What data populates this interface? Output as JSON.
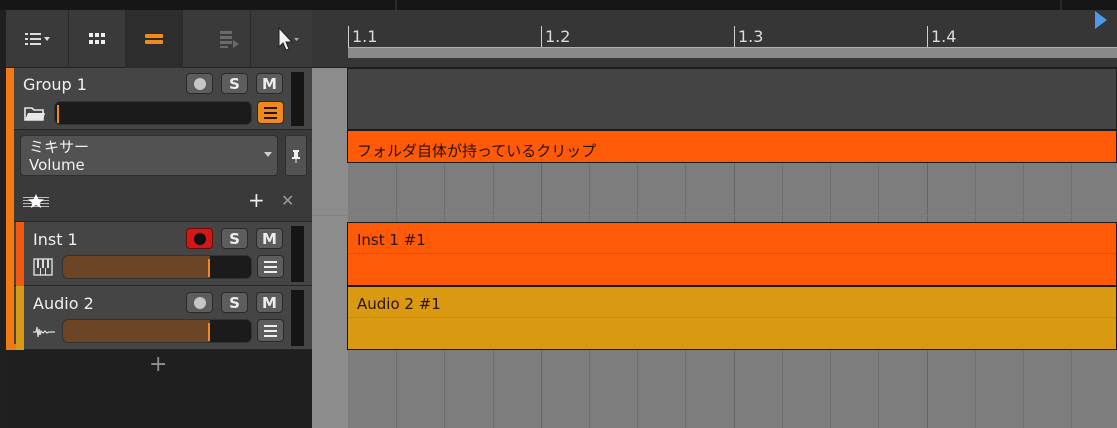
{
  "toolbar": {
    "track_menu_icon": "track-list-icon",
    "grid_view_icon": "grid-icon",
    "arrange_view_icon": "arrange-view-icon",
    "clip_launcher_icon": "clip-launcher-icon",
    "pointer_tool_icon": "pointer-arrow-icon"
  },
  "ruler": {
    "labels": [
      "1.1",
      "1.2",
      "1.3",
      "1.4"
    ]
  },
  "tracks": {
    "group": {
      "name": "Group 1",
      "solo_label": "S",
      "mute_label": "M",
      "color": "#f27a14",
      "icon": "folder-icon",
      "volume_level": 0.0
    },
    "automation": {
      "target_line1": "ミキサー",
      "target_line2": "Volume",
      "add_label": "+",
      "close_label": "✕"
    },
    "inst": {
      "name": "Inst 1",
      "solo_label": "S",
      "mute_label": "M",
      "color": "#f05a10",
      "icon": "piano-icon",
      "volume_level": 0.78,
      "armed": true
    },
    "audio": {
      "name": "Audio 2",
      "solo_label": "S",
      "mute_label": "M",
      "color": "#d89a14",
      "icon": "waveform-icon",
      "volume_level": 0.78,
      "armed": false
    },
    "add_track_label": "+"
  },
  "clips": {
    "folder_clip": "フォルダ自体が持っているクリップ",
    "inst_clip": "Inst 1 #1",
    "audio_clip": "Audio 2 #1"
  },
  "colors": {
    "accent_orange": "#fe5a08",
    "audio_gold": "#d99a12",
    "record_red": "#e01818",
    "playhead_blue": "#4a9be8"
  }
}
